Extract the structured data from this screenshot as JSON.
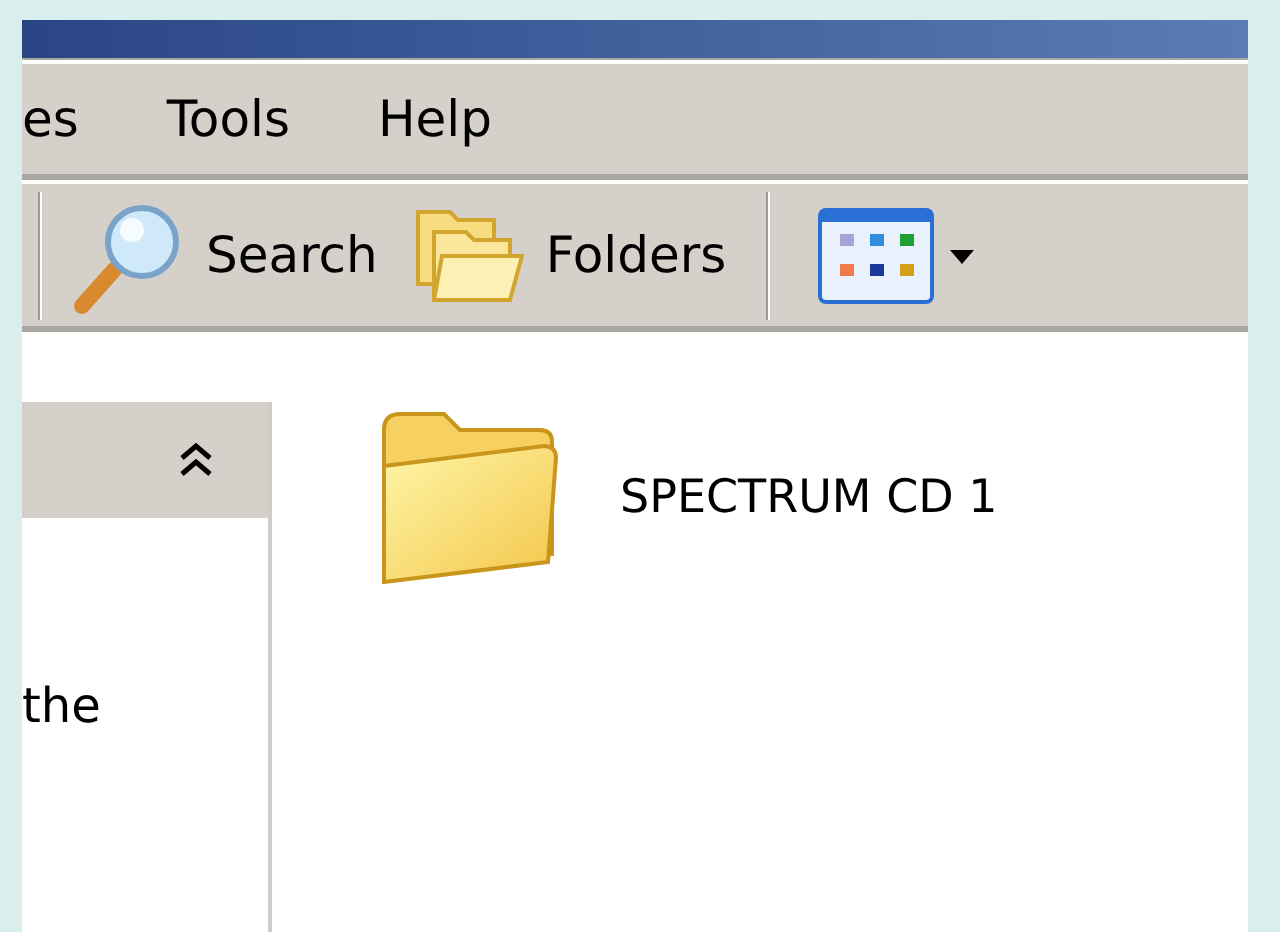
{
  "menu_bar": {
    "items": [
      "es",
      "Tools",
      "Help"
    ]
  },
  "toolbar": {
    "buttons": [
      {
        "kind": "search",
        "label": "Search"
      },
      {
        "kind": "folders",
        "label": "Folders"
      },
      {
        "kind": "views"
      }
    ]
  },
  "task_pane": {
    "text": "the"
  },
  "files": [
    {
      "name": "SPECTRUM CD 1"
    }
  ]
}
